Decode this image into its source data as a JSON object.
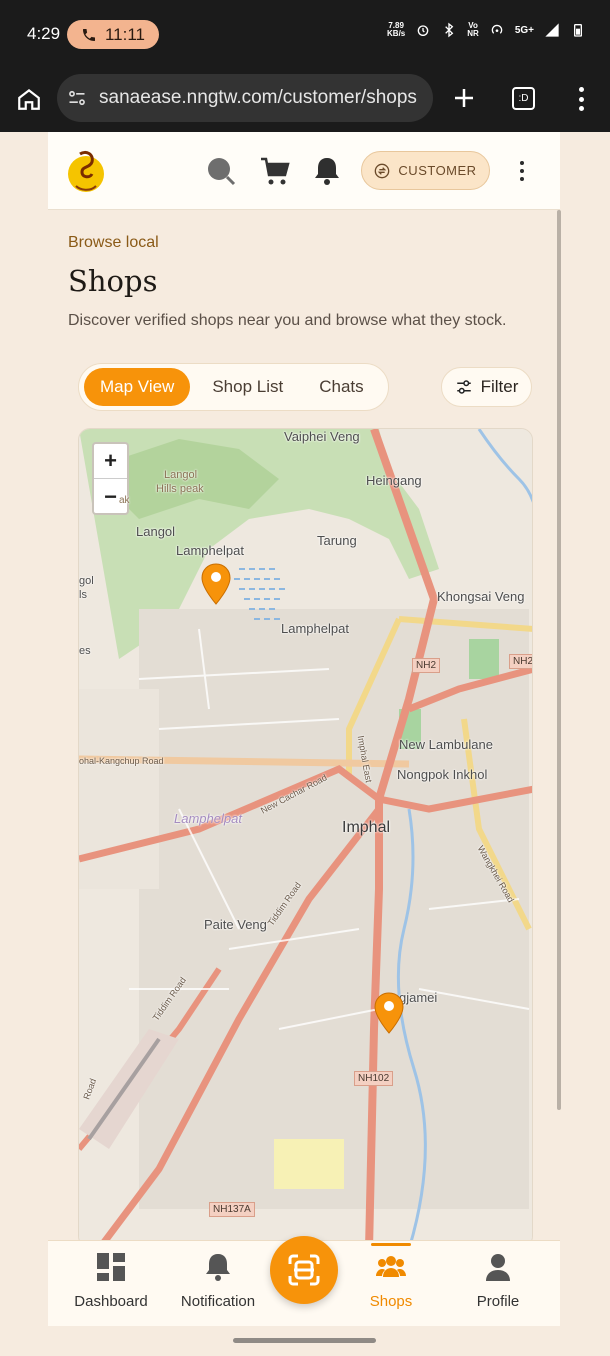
{
  "status_bar": {
    "time": "4:29",
    "call_timer": "11:11",
    "net_speed_value": "7.89",
    "net_speed_unit": "KB/s",
    "volte": "Vo",
    "nr": "NR",
    "network": "5G+"
  },
  "browser": {
    "url": "sanaease.nngtw.com/customer/shops",
    "tab_count": ":D"
  },
  "header": {
    "role_label": "CUSTOMER"
  },
  "page": {
    "eyebrow": "Browse local",
    "title": "Shops",
    "subtitle": "Discover verified shops near you and browse what they stock."
  },
  "tabs": {
    "map_view": "Map View",
    "shop_list": "Shop List",
    "chats": "Chats",
    "filter": "Filter"
  },
  "map": {
    "zoom_in": "+",
    "zoom_out": "−",
    "labels": {
      "vaiphei_veng": "Vaiphei Veng",
      "heingang": "Heingang",
      "langol_hills_peak_1": "Langol",
      "langol_hills_peak_2": "Hills peak",
      "langol": "Langol",
      "lamphelpat_top": "Lamphelpat",
      "tarung": "Tarung",
      "khongsai_veng": "Khongsai Veng",
      "lamphelpat_mid": "Lamphelpat",
      "nh2": "NH2",
      "nh2_right": "NH2",
      "new_lambulane": "New Lambulane",
      "nongpok_inkhol": "Nongpok Inkhol",
      "kangchup_road": "ohal-Kangchup Road",
      "new_cachar_road": "New Cachar Road",
      "imphal_east": "Imphal East",
      "lamphelpat_ital": "Lamphelpat",
      "imphal": "Imphal",
      "tiddim_road": "Tiddim Road",
      "paite_veng": "Paite Veng",
      "wangkhei_road": "Wangkhei Road",
      "tiddim_road_2": "Tiddim Road",
      "ngjamei": "gjamei",
      "nh102": "NH102",
      "nh137a": "NH137A",
      "gol_partial": "gol",
      "ls_partial": "ls",
      "es_partial": "es",
      "ak_partial": "ak",
      "road_partial": "Road"
    }
  },
  "bottom_nav": {
    "dashboard": "Dashboard",
    "notification": "Notification",
    "shops": "Shops",
    "profile": "Profile"
  },
  "colors": {
    "accent": "#f7930a",
    "background": "#f6ebdf",
    "eyebrow": "#8a5a17"
  }
}
